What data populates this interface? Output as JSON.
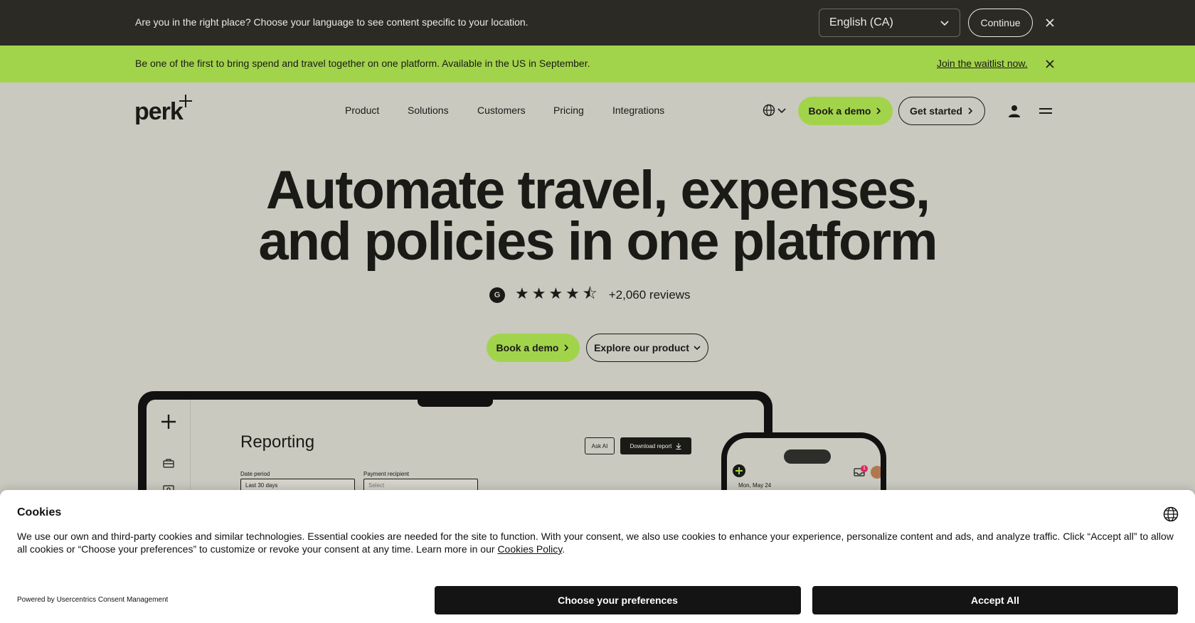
{
  "language_bar": {
    "message": "Are you in the right place? Choose your language to see content specific to your location.",
    "selected_language": "English (CA)",
    "continue_label": "Continue"
  },
  "promo_bar": {
    "message": "Be one of the first to bring spend and travel together on one platform. Available in the US in September.",
    "link_label": "Join the waitlist now."
  },
  "nav": {
    "logo_text": "perk",
    "items": [
      {
        "label": "Product"
      },
      {
        "label": "Solutions"
      },
      {
        "label": "Customers"
      },
      {
        "label": "Pricing"
      },
      {
        "label": "Integrations"
      }
    ],
    "book_demo_label": "Book a demo",
    "get_started_label": "Get started"
  },
  "hero": {
    "title_line1": "Automate travel, expenses,",
    "title_line2": "and policies in one platform",
    "g2_badge": "G",
    "rating_stars": 4.5,
    "stars_display": "★★★★⯪",
    "reviews_text": "+2,060 reviews",
    "book_demo_label": "Book a demo",
    "explore_label": "Explore our product"
  },
  "laptop_mockup": {
    "page_title": "Reporting",
    "ask_ai_label": "Ask AI",
    "download_label": "Download report",
    "date_period_label": "Date period",
    "date_period_value": "Last 30 days",
    "payment_recipient_label": "Payment recipient",
    "payment_recipient_value": "Select"
  },
  "phone_mockup": {
    "date_text": "Mon, May 24",
    "notification_count": "1"
  },
  "cookie_banner": {
    "title": "Cookies",
    "text": "We use our own and third-party cookies and similar technologies. Essential cookies are needed for the site to function. With your consent, we also use cookies to enhance your experience, personalize content and ads, and analyze traffic. Click “Accept all” to allow all cookies or “Choose your preferences” to customize or revoke your consent at any time. Learn more in our ",
    "policy_link": "Cookies Policy",
    "text_end": ".",
    "powered_by": "Powered by Usercentrics Consent Management",
    "preferences_label": "Choose your preferences",
    "accept_label": "Accept All"
  },
  "colors": {
    "accent_green": "#a2d44b",
    "page_bg": "#c9c9c0",
    "dark_bar": "#2b2a25",
    "ink": "#1a1a17"
  }
}
